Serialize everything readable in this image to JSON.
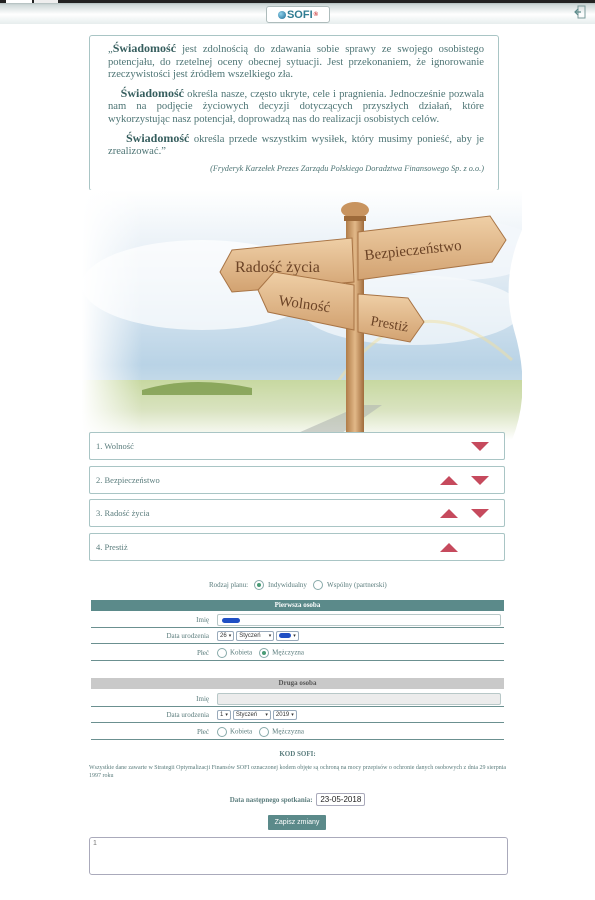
{
  "header": {
    "logo_text": "SOFI",
    "logo_mark": "®"
  },
  "quote": {
    "p1_kw": "Świadomość",
    "p1_rest": " jest zdolnością do zdawania sobie sprawy ze swojego osobistego potencjału, do rzetelnej oceny obecnej sytuacji. Jest przekonaniem, że ignorowanie rzeczywistości jest źródłem wszelkiego zła.",
    "p2_kw": "Świadomość",
    "p2_rest": " określa nasze, często ukryte, cele i pragnienia. Jednocześnie pozwala nam na podjęcie życiowych decyzji dotyczących przyszłych działań, które wykorzystując nasz potencjał, doprowadzą nas do realizacji osobistych celów.",
    "p3_kw": "Świadomość",
    "p3_rest": " określa przede wszystkim wysiłek, który musimy ponieść, aby je zrealizować.”",
    "open_mark": "„",
    "author": "(Fryderyk Karzełek Prezes Zarządu Polskiego Doradztwa Finansowego Sp. z o.o.)"
  },
  "signpost": {
    "sign1": "Radość życia",
    "sign2": "Bezpieczeństwo",
    "sign3": "Wolność",
    "sign4": "Prestiż"
  },
  "accordion": [
    {
      "label": "1. Wolność"
    },
    {
      "label": "2. Bezpieczeństwo"
    },
    {
      "label": "3. Radość życia"
    },
    {
      "label": "4. Prestiż"
    }
  ],
  "form": {
    "plan_label": "Rodzaj planu:",
    "plan_opt1": "Indywidualny",
    "plan_opt2": "Wspólny (partnerski)",
    "person1": {
      "header": "Pierwsza osoba",
      "name_label": "Imię",
      "dob_label": "Data urodzenia",
      "dob_day": "26",
      "dob_month": "Styczeń",
      "sex_label": "Płeć",
      "sex_f": "Kobieta",
      "sex_m": "Mężczyzna"
    },
    "person2": {
      "header": "Druga osoba",
      "name_label": "Imię",
      "dob_label": "Data urodzenia",
      "dob_day": "1",
      "dob_month": "Styczeń",
      "dob_year": "2019",
      "sex_label": "Płeć",
      "sex_f": "Kobieta",
      "sex_m": "Mężczyzna"
    },
    "kod_label": "KOD SOFI:",
    "legal": "Wszystkie dane zawarte w Strategii Optymalizacji Finansów SOFI oznaczonej kodem objęte są ochroną na mocy przepisów o ochronie danych osobowych z dnia 29 sierpnia 1997 roku",
    "next_label": "Data następnego spotkania:",
    "next_date": "23-05-2018",
    "save_label": "Zapisz zmiany",
    "notes_value": "1"
  },
  "colors": {
    "accent": "#5b8a8a",
    "arrow": "#c64a5d",
    "second_header": "#c9c9c9"
  }
}
